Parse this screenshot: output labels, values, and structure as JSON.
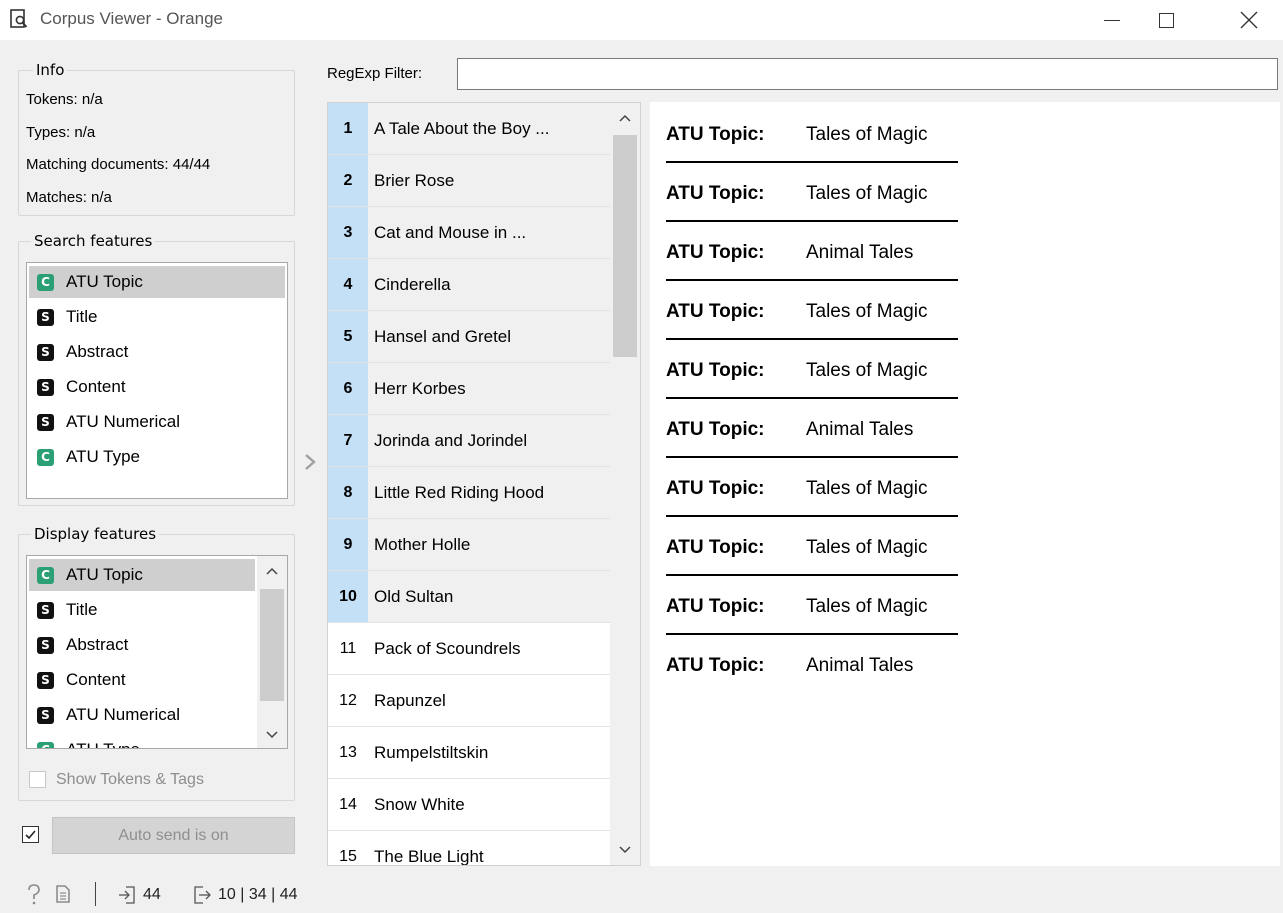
{
  "window": {
    "title": "Corpus Viewer - Orange",
    "minimize_glyph": "—",
    "maximize_glyph": "☐",
    "close_glyph": "✕"
  },
  "info": {
    "title": "Info",
    "tokens": "Tokens: n/a",
    "types": "Types: n/a",
    "matching": "Matching documents: 44/44",
    "matches": "Matches: n/a"
  },
  "search_features": {
    "title": "Search features",
    "items": [
      {
        "badge": "C",
        "label": "ATU Topic",
        "selected": true
      },
      {
        "badge": "S",
        "label": "Title"
      },
      {
        "badge": "S",
        "label": "Abstract"
      },
      {
        "badge": "S",
        "label": "Content"
      },
      {
        "badge": "S",
        "label": "ATU Numerical"
      },
      {
        "badge": "C",
        "label": "ATU Type"
      }
    ]
  },
  "display_features": {
    "title": "Display features",
    "items": [
      {
        "badge": "C",
        "label": "ATU Topic",
        "selected": true
      },
      {
        "badge": "S",
        "label": "Title"
      },
      {
        "badge": "S",
        "label": "Abstract"
      },
      {
        "badge": "S",
        "label": "Content"
      },
      {
        "badge": "S",
        "label": "ATU Numerical"
      },
      {
        "badge": "C",
        "label": "ATU Type"
      }
    ],
    "show_tokens_label": "Show Tokens & Tags",
    "show_tokens_checked": false
  },
  "auto_send": {
    "checked": true,
    "label": "Auto send is on"
  },
  "regexp": {
    "label": "RegExp Filter:",
    "value": ""
  },
  "documents": [
    {
      "num": "1",
      "title": "A Tale About the Boy ...",
      "selected": true
    },
    {
      "num": "2",
      "title": "Brier Rose",
      "selected": true
    },
    {
      "num": "3",
      "title": "Cat and Mouse in ...",
      "selected": true
    },
    {
      "num": "4",
      "title": "Cinderella",
      "selected": true
    },
    {
      "num": "5",
      "title": "Hansel and Gretel",
      "selected": true
    },
    {
      "num": "6",
      "title": "Herr Korbes",
      "selected": true
    },
    {
      "num": "7",
      "title": "Jorinda and Jorindel",
      "selected": true
    },
    {
      "num": "8",
      "title": "Little Red Riding Hood",
      "selected": true
    },
    {
      "num": "9",
      "title": "Mother Holle",
      "selected": true
    },
    {
      "num": "10",
      "title": "Old Sultan",
      "selected": true
    },
    {
      "num": "11",
      "title": "Pack of Scoundrels",
      "selected": false
    },
    {
      "num": "12",
      "title": "Rapunzel",
      "selected": false
    },
    {
      "num": "13",
      "title": "Rumpelstiltskin",
      "selected": false
    },
    {
      "num": "14",
      "title": "Snow White",
      "selected": false
    },
    {
      "num": "15",
      "title": "The Blue Light",
      "selected": false
    }
  ],
  "content": {
    "key": "ATU Topic:",
    "values": [
      "Tales of Magic",
      "Tales of Magic",
      "Animal Tales",
      "Tales of Magic",
      "Tales of Magic",
      "Animal Tales",
      "Tales of Magic",
      "Tales of Magic",
      "Tales of Magic",
      "Animal Tales"
    ]
  },
  "statusbar": {
    "input_count": "44",
    "output_counts": "10 | 34 | 44"
  },
  "colors": {
    "continuous_badge": "#2aa074",
    "string_badge": "#111111",
    "selection_blue": "#c4e0f6"
  }
}
